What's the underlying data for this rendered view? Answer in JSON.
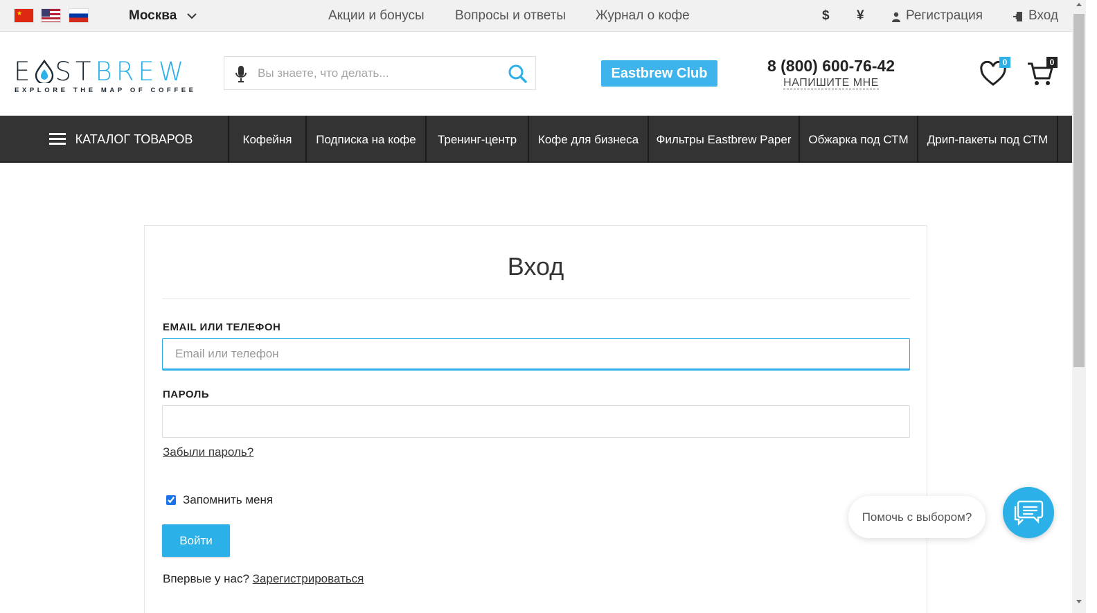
{
  "topbar": {
    "flags": [
      "china-flag-icon",
      "usa-flag-icon",
      "russia-flag-icon"
    ],
    "city": "Москва",
    "links": [
      "Акции и бонусы",
      "Вопросы и ответы",
      "Журнал о кофе"
    ],
    "currencies": [
      "$",
      "¥"
    ],
    "register": "Регистрация",
    "login": "Вход"
  },
  "header": {
    "logo_part1": "E",
    "logo_part2": "ST",
    "logo_part3": "BREW",
    "logo_tagline": "EXPLORE THE MAP OF COFFEE",
    "search_placeholder": "Вы знаете, что делать...",
    "club_label": "Eastbrew Club",
    "phone": "8 (800) 600-76-42",
    "write_me": "НАПИШИТЕ МНЕ",
    "favorites_count": "0",
    "cart_count": "0"
  },
  "nav": {
    "catalog": "КАТАЛОГ ТОВАРОВ",
    "items": [
      "Кофейня",
      "Подписка на кофе",
      "Тренинг-центр",
      "Кофе для бизнеса",
      "Фильтры Eastbrew Paper",
      "Обжарка под СТМ",
      "Дрип-пакеты под СТМ"
    ]
  },
  "login": {
    "title": "Вход",
    "email_label": "EMAIL ИЛИ ТЕЛЕФОН",
    "email_placeholder": "Email или телефон",
    "password_label": "ПАРОЛЬ",
    "forgot": "Забыли пароль?",
    "remember": "Запомнить меня",
    "remember_checked": true,
    "submit": "Войти",
    "first_time": "Впервые у нас?",
    "register_link": "Зарегистрироваться"
  },
  "chat": {
    "bubble": "Помочь с выбором?"
  },
  "colors": {
    "accent": "#2bb0e8",
    "nav_bg": "#333333",
    "topbar_bg": "#f1f1f1"
  }
}
